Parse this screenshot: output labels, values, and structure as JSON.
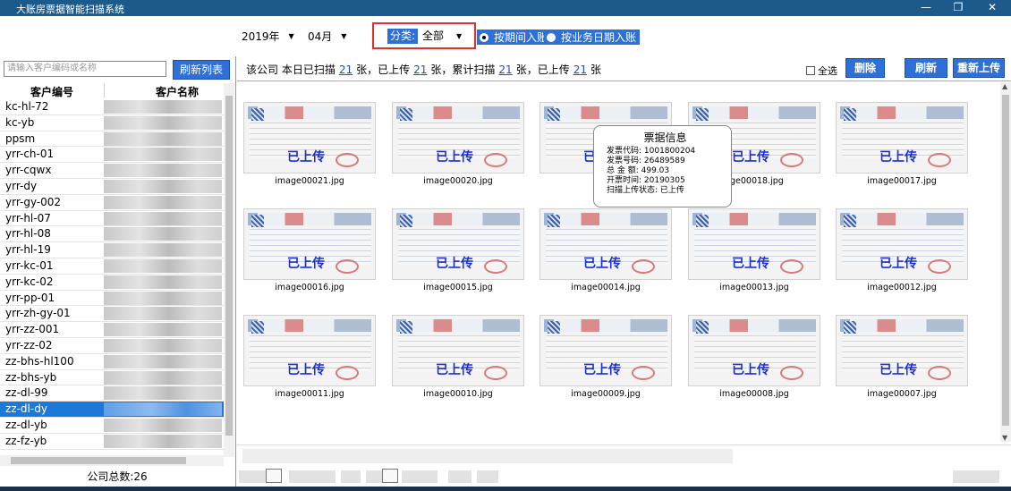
{
  "window": {
    "title": "大账房票据智能扫描系统",
    "minimize": "—",
    "maximize": "❐",
    "close": "✕"
  },
  "toolbar": {
    "year": "2019年",
    "month": "04月",
    "dropdown_arrow": "▼",
    "category_label": "分类:",
    "category_value": "全部",
    "radio_period": "按期间入账",
    "radio_business": "按业务日期入账"
  },
  "sidebar": {
    "search_placeholder": "请输入客户编码或名称",
    "refresh_button": "刷新列表",
    "col_code": "客户编号",
    "col_name": "客户名称",
    "customers": [
      "kc-hl-72",
      "kc-yb",
      "ppsm",
      "yrr-ch-01",
      "yrr-cqwx",
      "yrr-dy",
      "yrr-gy-002",
      "yrr-hl-07",
      "yrr-hl-08",
      "yrr-hl-19",
      "yrr-kc-01",
      "yrr-kc-02",
      "yrr-pp-01",
      "yrr-zh-gy-01",
      "yrr-zz-001",
      "yrr-zz-02",
      "zz-bhs-hl100",
      "zz-bhs-yb",
      "zz-dl-99",
      "zz-dl-dy",
      "zz-dl-yb",
      "zz-fz-yb"
    ],
    "selected": "zz-dl-dy",
    "total": "公司总数:26"
  },
  "info": {
    "t1": "该公司  本日已扫描",
    "n1": "21",
    "t2": "张，已上传",
    "n2": "21",
    "t3": "张，累计扫描",
    "n3": "21",
    "t4": "张，已上传",
    "n4": "21",
    "t5": "张",
    "select_all": "全选",
    "delete": "删除",
    "refresh": "刷新",
    "reupload": "重新上传"
  },
  "gallery": {
    "status_label": "已上传",
    "files": [
      "image00021.jpg",
      "image00020.jpg",
      "image00019.jpg",
      "image00018.jpg",
      "image00017.jpg",
      "image00016.jpg",
      "image00015.jpg",
      "image00014.jpg",
      "image00013.jpg",
      "image00012.jpg",
      "image00011.jpg",
      "image00010.jpg",
      "image00009.jpg",
      "image00008.jpg",
      "image00007.jpg"
    ],
    "visible_names": [
      "image00021.jpg",
      "image00020.jpg",
      "imag",
      "age00018.jpg",
      "image00017.jpg",
      "image00016.jpg",
      "image00015.jpg",
      "image00014.jpg",
      "image00013.jpg",
      "image00012.jpg",
      "image00011.jpg",
      "image00010.jpg",
      "image00009.jpg",
      "image00008.jpg",
      "image00007.jpg"
    ]
  },
  "tooltip": {
    "title": "票据信息",
    "code": "发票代码: 1001800204",
    "number": "发票号码: 26489589",
    "amount": "总 金 额: 499.03",
    "date": "开票时间: 20190305",
    "status": "扫描上传状态: 已上传"
  }
}
